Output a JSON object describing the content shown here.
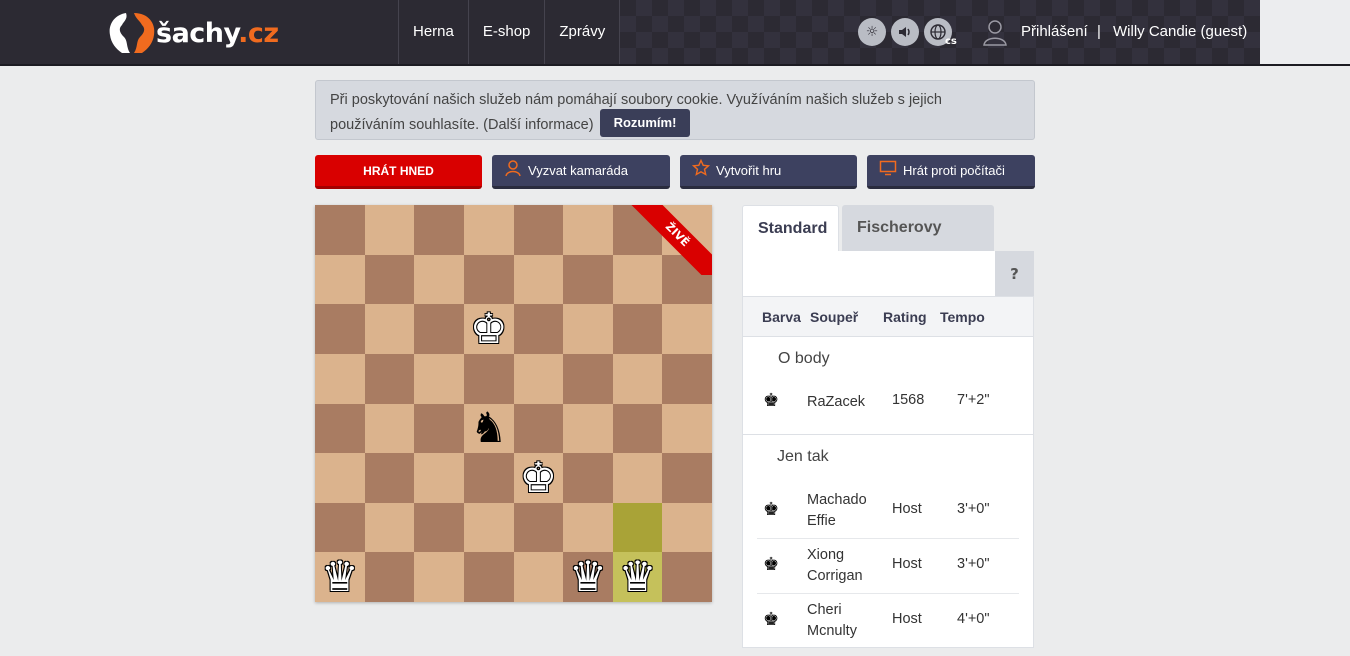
{
  "header": {
    "logo_name": "šachy",
    "logo_tld": ".cz",
    "nav": [
      "Herna",
      "E-shop",
      "Zprávy"
    ],
    "lang_code": "cs",
    "login": "Přihlášení",
    "separator": "|",
    "user": "Willy Candie (guest)"
  },
  "cookie": {
    "text": "Při poskytování našich služeb nám pomáhají soubory cookie. Využíváním našich služeb s jejich používáním souhlasíte.",
    "more": "(Další informace)",
    "accept": "Rozumím!"
  },
  "actions": {
    "play_now": "HRÁT HNED",
    "challenge_friend": "Vyzvat kamaráda",
    "create_game": "Vytvořit hru",
    "play_computer": "Hrát proti počítači"
  },
  "board": {
    "live_ribbon": "ŽIVĚ",
    "pieces": [
      {
        "square": "d6",
        "glyph": "♚",
        "color": "white"
      },
      {
        "square": "d4",
        "glyph": "♞",
        "color": "black"
      },
      {
        "square": "e3",
        "glyph": "♚",
        "color": "white"
      },
      {
        "square": "a1",
        "glyph": "♛",
        "color": "white"
      },
      {
        "square": "f1",
        "glyph": "♛",
        "color": "white"
      },
      {
        "square": "g1",
        "glyph": "♛",
        "color": "white"
      }
    ],
    "highlighted": [
      "g2",
      "g1"
    ],
    "colors": {
      "light": "#dbb38d",
      "dark": "#a97c62",
      "highlight_light": "#c5c15b",
      "highlight_dark": "#a9a337"
    }
  },
  "lobby": {
    "tabs": [
      "Standard",
      "Fischerovy šachy"
    ],
    "help": "?",
    "columns": [
      "Barva",
      "Soupeř",
      "Rating",
      "Tempo"
    ],
    "groups": [
      {
        "label": "O body",
        "rows": [
          {
            "color_icon": "black-king-icon",
            "name": "RaZacek",
            "rating": "1568",
            "tempo": "7'+2\""
          }
        ]
      },
      {
        "label": "Jen tak",
        "rows": [
          {
            "color_icon": "black-king-icon",
            "name": "Machado Effie",
            "rating": "Host",
            "tempo": "3'+0\""
          },
          {
            "color_icon": "black-king-icon",
            "name": "Xiong Corrigan",
            "rating": "Host",
            "tempo": "3'+0\""
          },
          {
            "color_icon": "black-king-icon",
            "name": "Cheri Mcnulty",
            "rating": "Host",
            "tempo": "4'+0\""
          }
        ]
      }
    ]
  },
  "colors": {
    "accent": "#f06b1f",
    "play_red": "#d90000",
    "navy": "#3d4160",
    "topbar": "#2c2a33"
  }
}
